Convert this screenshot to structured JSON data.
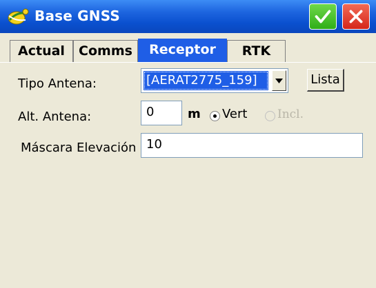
{
  "window": {
    "title": "Base GNSS",
    "ok_icon": "check-icon",
    "cancel_icon": "close-icon",
    "app_icon": "satellite-icon"
  },
  "tabs": [
    {
      "label": "Actual"
    },
    {
      "label": "Comms"
    },
    {
      "label": "Receptor",
      "active": true
    },
    {
      "label": "RTK"
    }
  ],
  "form": {
    "antenna_type": {
      "label": "Tipo Antena:",
      "value": "[AERAT2775_159]",
      "list_button": "Lista"
    },
    "antenna_height": {
      "label": "Alt. Antena:",
      "value": "0",
      "unit": "m",
      "options": {
        "vert": "Vert",
        "incl": "Incl."
      },
      "selected": "Vert"
    },
    "elevation_mask": {
      "label": "Máscara Elevación",
      "value": "10"
    }
  },
  "colors": {
    "titlebar": "#0a50cf",
    "selection": "#1f5ee6",
    "ok": "#2fae18",
    "cancel": "#d5261a",
    "background": "#ece9d8"
  }
}
